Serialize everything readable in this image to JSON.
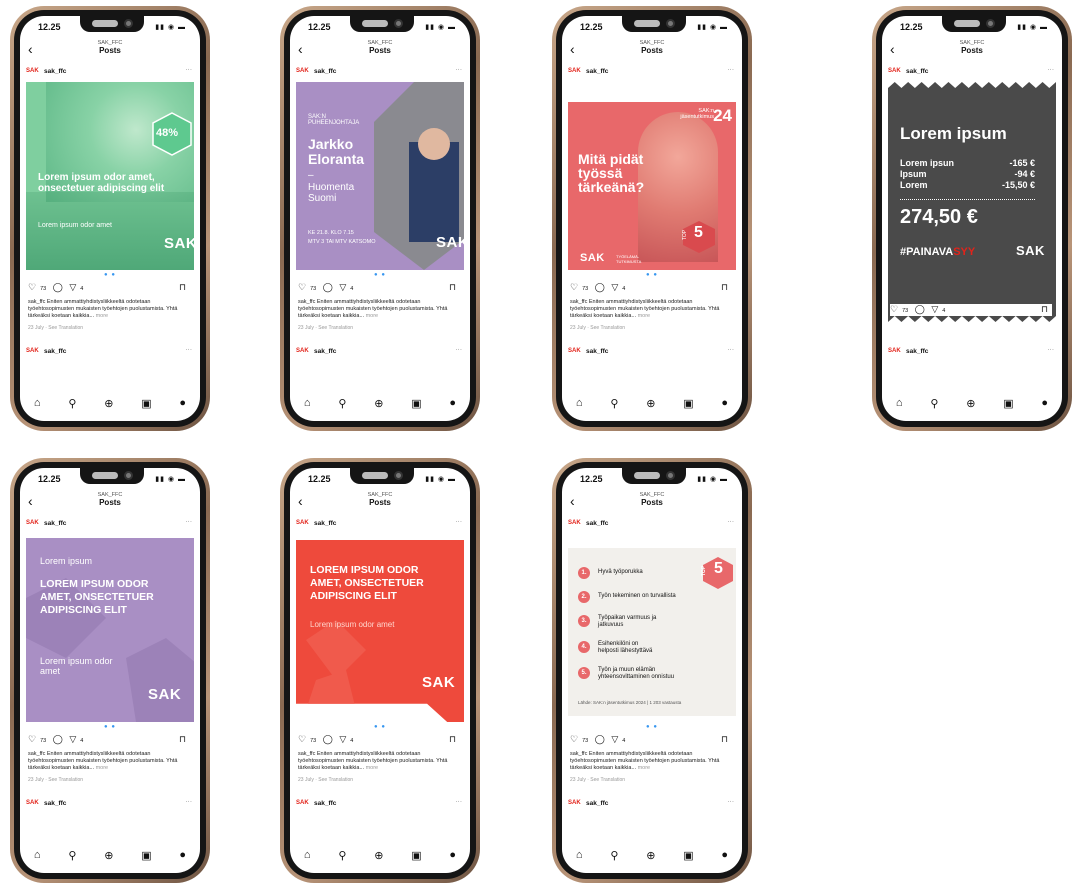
{
  "common": {
    "time": "12.25",
    "account": "SAK_FFC",
    "header_title": "Posts",
    "back": "‹",
    "logo": "SAK",
    "username": "sak_ffc",
    "dots": "···",
    "likes": "73",
    "shares": "4",
    "caption": "sak_ffc Eniten ammattiyhdistysliikkeeltä odotetaan työehtosopimusten mukaisten työehtojen puolustamista. Yhtä tärkeäksi koetaan kaikkia...",
    "more": "more",
    "date": "23 July · See Translation",
    "pager": "● ●"
  },
  "posts": {
    "p1": {
      "badge": "48%",
      "headline": "Lorem ipsum odor amet, onsectetuer adipiscing elit",
      "sub": "Lorem ipsum odor amet",
      "brand": "SAK",
      "colors": {
        "bg": "#7fcf9f"
      }
    },
    "p2": {
      "kicker": "SAK:N PUHEENJOHTAJA",
      "name": "Jarkko Eloranta",
      "dash": "–",
      "show": "Huomenta Suomi",
      "when1": "KE 21.8. KLO 7.15",
      "when2": "MTV 3 TAI MTV KATSOMO",
      "brand": "SAK",
      "colors": {
        "bg": "#a98fc4"
      }
    },
    "p3": {
      "corner": "SAK:n jäsentutkimus",
      "year": "24",
      "headline": "Mitä pidät työssä tärkeänä?",
      "top": "TOP",
      "five": "5",
      "brand": "SAK",
      "tag": "TYÖELÄMÄ-TUTKIMUSTA",
      "colors": {
        "bg": "#e8686a"
      }
    },
    "p4": {
      "title": "Lorem ipsum",
      "rows": [
        {
          "label": "Lorem ipsun",
          "value": "-165 €"
        },
        {
          "label": "Ipsum",
          "value": "-94 €"
        },
        {
          "label": "Lorem",
          "value": "-15,50 €"
        }
      ],
      "total": "274,50 €",
      "hashtag1": "#PAINAVA",
      "hashtag2": "SYY",
      "brand": "SAK",
      "colors": {
        "bg": "#4a4a4a",
        "accent": "#e2231a"
      }
    },
    "p5": {
      "small": "Lorem ipsum",
      "headline": "LOREM IPSUM ODOR AMET, ONSECTETUER ADIPISCING ELIT",
      "sub": "Lorem ipsum odor amet",
      "brand": "SAK",
      "colors": {
        "bg": "#a98fc4"
      }
    },
    "p6": {
      "headline": "LOREM IPSUM ODOR AMET, ONSECTETUER ADIPISCING ELIT",
      "sub": "Lorem ipsum odor amet",
      "brand": "SAK",
      "colors": {
        "bg": "#ee4a3c"
      }
    },
    "p7": {
      "top": "TOP",
      "five": "5",
      "items": [
        {
          "n": "1.",
          "text": "Hyvä työporukka"
        },
        {
          "n": "2.",
          "text": "Työn tekeminen on turvallista"
        },
        {
          "n": "3.",
          "text": "Työpaikan varmuus ja jatkuvuus"
        },
        {
          "n": "4.",
          "text": "Esihenkilöni on helposti lähestyttävä"
        },
        {
          "n": "5.",
          "text": "Työn ja muun elämän yhteensovittaminen onnistuu"
        }
      ],
      "source": "Lähde: SAK:n jäsentutkimus 2024 | 1 203 vastausta",
      "colors": {
        "bg": "#f2f0ec",
        "accent": "#e8686a"
      }
    }
  }
}
